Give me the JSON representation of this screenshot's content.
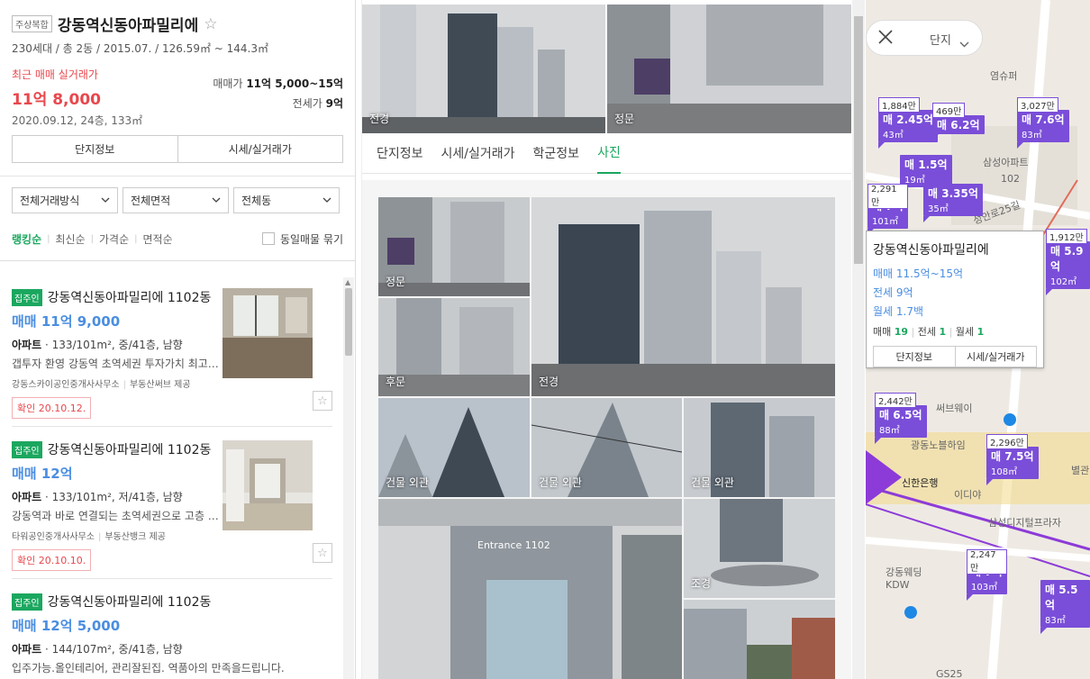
{
  "complex": {
    "tag": "주상복합",
    "name": "강동역신동아파밀리에",
    "summary": "230세대 / 총 2동 / 2015.07. / 126.59㎡ ~ 144.3㎡",
    "recent_label": "최근 매매 실거래가",
    "recent_price": "11억 8,000",
    "recent_date": "2020.09.12, 24층, 133㎡",
    "sale_label": "매매가",
    "sale_range": "11억 5,000~15억",
    "lease_label": "전세가",
    "lease_value": "9억",
    "btn_info": "단지정보",
    "btn_price": "시세/실거래가"
  },
  "filters": {
    "trade": "전체거래방식",
    "area": "전체면적",
    "dong": "전체동"
  },
  "sorts": {
    "ranking": "랭킹순",
    "recent": "최신순",
    "price": "가격순",
    "area": "면적순",
    "group": "동일매물 묶기"
  },
  "listings": [
    {
      "badge": "집주인",
      "title": "강동역신동아파밀리에 1102동",
      "price": "매매 11억 9,000",
      "type": "아파트",
      "spec": "133/101m², 중/41층, 남향",
      "desc": "갭투자 환영 강동역 초역세권 투자가치 최고입니다",
      "agent": "강동스카이공인중개사사무소",
      "provider": "부동산써브 제공",
      "confirm": "확인 20.10.12."
    },
    {
      "badge": "집주인",
      "title": "강동역신동아파밀리에 1102동",
      "price": "매매 12억",
      "type": "아파트",
      "spec": "133/101m², 저/41층, 남향",
      "desc": "강동역과 바로 연결되는 초역세권으로 고층 전망 우수",
      "agent": "타워공인중개사사무소",
      "provider": "부동산뱅크 제공",
      "confirm": "확인 20.10.10."
    },
    {
      "badge": "집주인",
      "title": "강동역신동아파밀리에 1102동",
      "price": "매매 12억 5,000",
      "type": "아파트",
      "spec": "144/107m², 중/41층, 남향",
      "desc": "입주가능.올인테리어, 관리잘된집. 역품아의 만족을드립니다."
    }
  ],
  "photos": {
    "top": [
      "전경",
      "정문"
    ],
    "tabs": [
      "단지정보",
      "시세/실거래가",
      "학군정보",
      "사진"
    ],
    "grid": [
      "정문",
      "전경",
      "후문",
      "건물 외관",
      "건물 외관",
      "건물 외관",
      "조경"
    ],
    "entrance_sign": "Entrance 1102"
  },
  "map": {
    "filter_label": "단지",
    "markers": [
      {
        "tag": "1,884만",
        "price": "매 2.45억",
        "area": "43㎡"
      },
      {
        "tag": "469만",
        "price": "매 6.2억",
        "area": ""
      },
      {
        "tag": "3,027만",
        "price": "매 7.6억",
        "area": "83㎡"
      },
      {
        "tag": "",
        "price": "매 1.5억",
        "area": "19㎡"
      },
      {
        "tag": "2,291만",
        "price": "매 7억",
        "area": "101㎡"
      },
      {
        "tag": "",
        "price": "매 3.35억",
        "area": "35㎡"
      },
      {
        "tag": "1,912만",
        "price": "매 5.9억",
        "area": "102㎡"
      },
      {
        "tag": "2,442만",
        "price": "매 6.5억",
        "area": "88㎡"
      },
      {
        "tag": "2,296만",
        "price": "매 7.5억",
        "area": "108㎡"
      },
      {
        "tag": "2,247만",
        "price": "매 7억",
        "area": "103㎡"
      },
      {
        "tag": "",
        "price": "매 5.5억",
        "area": "83㎡"
      }
    ],
    "labels": [
      "염슈퍼",
      "삼성아파트",
      "102",
      "성안로25길",
      "써브웨이",
      "광동노블하임",
      "신한은행",
      "이디야",
      "삼성디지털프라자",
      "강동웨딩 KDW",
      "GS25",
      "별관"
    ],
    "popup": {
      "title": "강동역신동아파밀리에",
      "sale": "매매 11.5억~15억",
      "lease": "전세 9억",
      "monthly": "월세 1.7백",
      "count_sale_label": "매매",
      "count_sale": "19",
      "count_lease_label": "전세",
      "count_lease": "1",
      "count_monthly_label": "월세",
      "count_monthly": "1",
      "btn_info": "단지정보",
      "btn_price": "시세/실거래가"
    }
  }
}
